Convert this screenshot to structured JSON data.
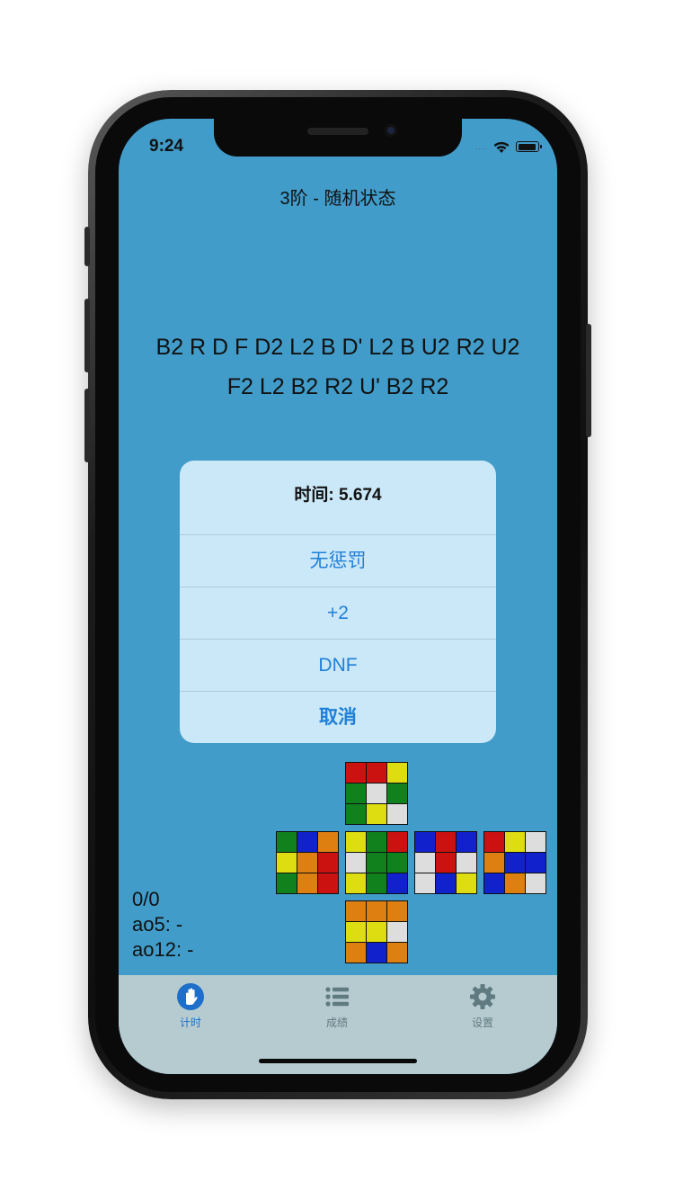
{
  "status_bar": {
    "time": "9:24",
    "signal_dots": "....",
    "icons": [
      "wifi-icon",
      "battery-icon"
    ]
  },
  "header": {
    "title": "3阶 - 随机状态"
  },
  "scramble": {
    "line1": "B2 R D F D2 L2 B D' L2 B U2 R2 U2",
    "line2": "F2 L2 B2 R2 U' B2 R2"
  },
  "alert": {
    "title": "时间: 5.674",
    "buttons": [
      "无惩罚",
      "+2",
      "DNF",
      "取消"
    ]
  },
  "stats": {
    "count": "0/0",
    "ao5": "ao5: -",
    "ao12": "ao12: -"
  },
  "cube_colors": {
    "R": "#cc1111",
    "G": "#11811e",
    "Y": "#dddd11",
    "W": "#dddddd",
    "B": "#1122cc",
    "O": "#dd7f11"
  },
  "cube_net": {
    "U": [
      "R",
      "R",
      "Y",
      "G",
      "W",
      "G",
      "G",
      "Y",
      "W"
    ],
    "L": [
      "G",
      "B",
      "O",
      "Y",
      "O",
      "R",
      "G",
      "O",
      "R"
    ],
    "F": [
      "Y",
      "G",
      "R",
      "W",
      "G",
      "G",
      "Y",
      "G",
      "B"
    ],
    "R": [
      "B",
      "R",
      "B",
      "W",
      "R",
      "W",
      "W",
      "B",
      "Y"
    ],
    "B": [
      "R",
      "Y",
      "W",
      "O",
      "B",
      "B",
      "B",
      "O",
      "W"
    ],
    "D": [
      "O",
      "O",
      "O",
      "Y",
      "Y",
      "W",
      "O",
      "B",
      "O"
    ]
  },
  "tabbar": {
    "tabs": [
      {
        "label": "计时",
        "icon": "hand-timer-icon",
        "active": true
      },
      {
        "label": "成绩",
        "icon": "list-icon",
        "active": false
      },
      {
        "label": "设置",
        "icon": "gear-icon",
        "active": false
      }
    ],
    "active_color": "#1d6fc9",
    "inactive_color": "#5f7a80"
  }
}
